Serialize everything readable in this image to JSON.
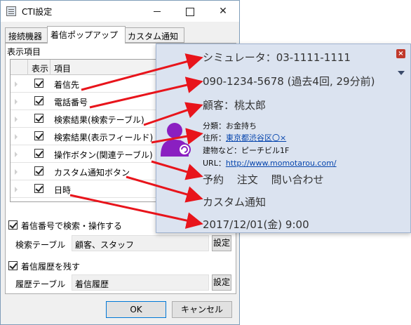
{
  "window": {
    "title": "CTI設定",
    "tabs": [
      "接続機器",
      "着信ポップアップ",
      "カスタム通知"
    ]
  },
  "panel": {
    "section_label": "表示項目",
    "columns": {
      "show": "表示",
      "item": "項目"
    },
    "rows": [
      {
        "label": "着信先",
        "checked": true
      },
      {
        "label": "電話番号",
        "checked": true
      },
      {
        "label": "検索結果(検索テーブル)",
        "checked": true
      },
      {
        "label": "検索結果(表示フィールド)",
        "checked": true
      },
      {
        "label": "操作ボタン(関連テーブル)",
        "checked": true
      },
      {
        "label": "カスタム通知ボタン",
        "checked": true
      },
      {
        "label": "日時",
        "checked": true
      }
    ],
    "search_checkbox_label": "着信番号で検索・操作する",
    "search_table_label": "検索テーブル",
    "search_table_value": "顧客、スタッフ",
    "history_checkbox_label": "着信履歴を残す",
    "history_table_label": "履歴テーブル",
    "history_table_value": "着信履歴",
    "set_button_label": "設定"
  },
  "buttons": {
    "ok": "OK",
    "cancel": "キャンセル"
  },
  "popup": {
    "line1": "シミュレータ：03-1111-1111",
    "line2": "090-1234-5678 (過去4回, 29分前)",
    "line3": "顧客：桃太郎",
    "detail_category": "分類：お金持ち",
    "detail_address_label": "住所：",
    "detail_address_link": "東京都渋谷区〇×",
    "detail_building": "建物など：ピーチビル1F",
    "detail_url_label": "URL：",
    "detail_url_link": "http://www.momotarou.com/",
    "actions": [
      "予約",
      "注文",
      "問い合わせ"
    ],
    "custom_notice": "カスタム通知",
    "datetime": "2017/12/01(金) 9:00",
    "close_symbol": "×"
  },
  "colors": {
    "arrow": "#e8141b",
    "avatar": "#8a1fc1",
    "popup_bg": "#dbe3f0"
  }
}
